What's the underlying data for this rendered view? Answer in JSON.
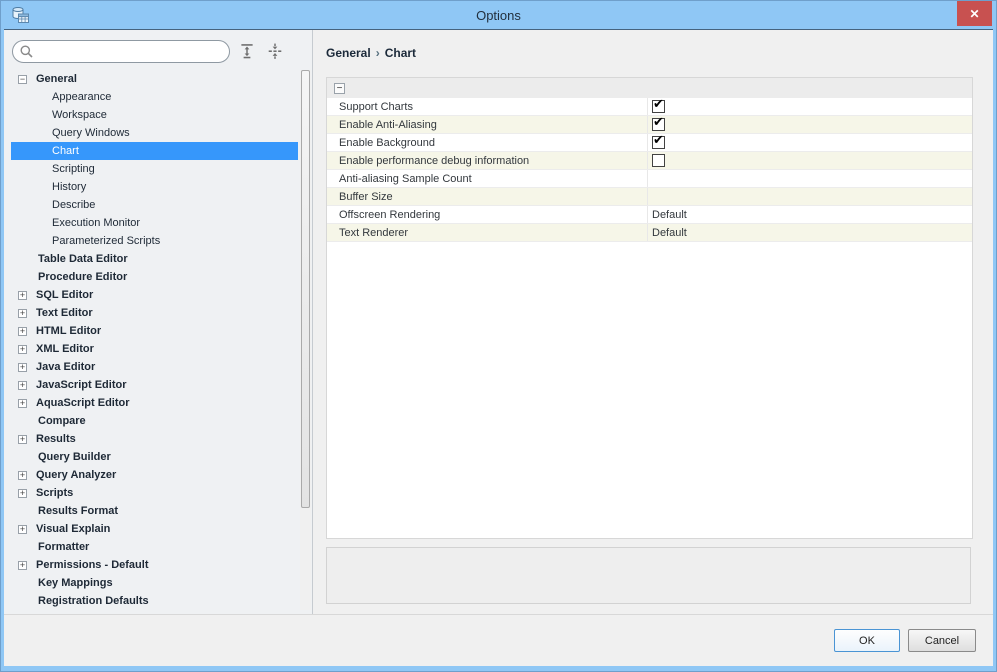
{
  "window": {
    "title": "Options"
  },
  "icons": {
    "app": "database-table-icon",
    "close": "✕",
    "search": "magnifier-icon",
    "expand_all": "expand-rows-icon",
    "collapse_all": "collapse-rows-icon",
    "tree_collapse": "−",
    "tree_expand": "+",
    "panel_collapse": "−",
    "check": "✔",
    "breadcrumb_separator": "›"
  },
  "sidebar": {
    "search_placeholder": "",
    "tree": [
      {
        "label": "General",
        "level": 0,
        "bold": true,
        "expander": "minus",
        "selected": false
      },
      {
        "label": "Appearance",
        "level": 1,
        "bold": false,
        "expander": "none",
        "selected": false
      },
      {
        "label": "Workspace",
        "level": 1,
        "bold": false,
        "expander": "none",
        "selected": false
      },
      {
        "label": "Query Windows",
        "level": 1,
        "bold": false,
        "expander": "none",
        "selected": false
      },
      {
        "label": "Chart",
        "level": 1,
        "bold": false,
        "expander": "none",
        "selected": true
      },
      {
        "label": "Scripting",
        "level": 1,
        "bold": false,
        "expander": "none",
        "selected": false
      },
      {
        "label": "History",
        "level": 1,
        "bold": false,
        "expander": "none",
        "selected": false
      },
      {
        "label": "Describe",
        "level": 1,
        "bold": false,
        "expander": "none",
        "selected": false
      },
      {
        "label": "Execution Monitor",
        "level": 1,
        "bold": false,
        "expander": "none",
        "selected": false
      },
      {
        "label": "Parameterized Scripts",
        "level": 1,
        "bold": false,
        "expander": "none",
        "selected": false
      },
      {
        "label": "Table Data Editor",
        "level": 0,
        "bold": true,
        "expander": "none",
        "selected": false
      },
      {
        "label": "Procedure Editor",
        "level": 0,
        "bold": true,
        "expander": "none",
        "selected": false
      },
      {
        "label": "SQL Editor",
        "level": 0,
        "bold": true,
        "expander": "plus",
        "selected": false
      },
      {
        "label": "Text Editor",
        "level": 0,
        "bold": true,
        "expander": "plus",
        "selected": false
      },
      {
        "label": "HTML Editor",
        "level": 0,
        "bold": true,
        "expander": "plus",
        "selected": false
      },
      {
        "label": "XML Editor",
        "level": 0,
        "bold": true,
        "expander": "plus",
        "selected": false
      },
      {
        "label": "Java Editor",
        "level": 0,
        "bold": true,
        "expander": "plus",
        "selected": false
      },
      {
        "label": "JavaScript Editor",
        "level": 0,
        "bold": true,
        "expander": "plus",
        "selected": false
      },
      {
        "label": "AquaScript Editor",
        "level": 0,
        "bold": true,
        "expander": "plus",
        "selected": false
      },
      {
        "label": "Compare",
        "level": 0,
        "bold": true,
        "expander": "none",
        "selected": false
      },
      {
        "label": "Results",
        "level": 0,
        "bold": true,
        "expander": "plus",
        "selected": false
      },
      {
        "label": "Query Builder",
        "level": 0,
        "bold": true,
        "expander": "none",
        "selected": false
      },
      {
        "label": "Query Analyzer",
        "level": 0,
        "bold": true,
        "expander": "plus",
        "selected": false
      },
      {
        "label": "Scripts",
        "level": 0,
        "bold": true,
        "expander": "plus",
        "selected": false
      },
      {
        "label": "Results Format",
        "level": 0,
        "bold": true,
        "expander": "none",
        "selected": false
      },
      {
        "label": "Visual Explain",
        "level": 0,
        "bold": true,
        "expander": "plus",
        "selected": false
      },
      {
        "label": "Formatter",
        "level": 0,
        "bold": true,
        "expander": "none",
        "selected": false
      },
      {
        "label": "Permissions - Default",
        "level": 0,
        "bold": true,
        "expander": "plus",
        "selected": false
      },
      {
        "label": "Key Mappings",
        "level": 0,
        "bold": true,
        "expander": "none",
        "selected": false
      },
      {
        "label": "Registration Defaults",
        "level": 0,
        "bold": true,
        "expander": "none",
        "selected": false
      }
    ]
  },
  "main": {
    "breadcrumb": [
      "General",
      "Chart"
    ],
    "grid": {
      "rows": [
        {
          "name": "Support Charts",
          "type": "checkbox",
          "checked": true
        },
        {
          "name": "Enable Anti-Aliasing",
          "type": "checkbox",
          "checked": true
        },
        {
          "name": "Enable Background",
          "type": "checkbox",
          "checked": true
        },
        {
          "name": "Enable performance debug information",
          "type": "checkbox",
          "checked": false
        },
        {
          "name": "Anti-aliasing Sample Count",
          "type": "text",
          "value": ""
        },
        {
          "name": "Buffer Size",
          "type": "text",
          "value": ""
        },
        {
          "name": "Offscreen Rendering",
          "type": "text",
          "value": "Default"
        },
        {
          "name": "Text Renderer",
          "type": "text",
          "value": "Default"
        }
      ]
    }
  },
  "footer": {
    "ok": "OK",
    "cancel": "Cancel"
  },
  "colors": {
    "titlebar": "#8fc7f5",
    "selection": "#3697fb",
    "close_button": "#c85150",
    "row_alt": "#f6f6e8"
  }
}
